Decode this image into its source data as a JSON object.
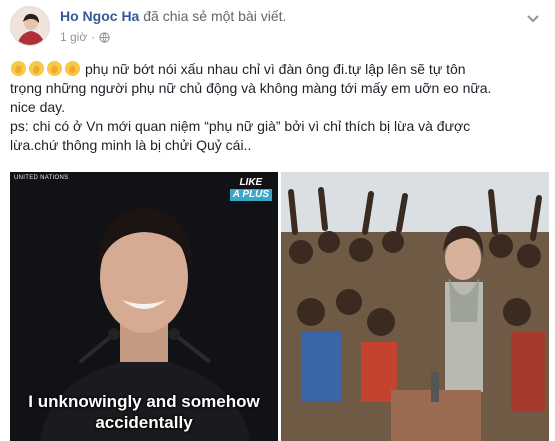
{
  "post": {
    "author_name": "Ho Ngoc Ha",
    "action": " đã chia sẻ một bài viết.",
    "time": "1 giờ",
    "privacy_icon": "globe-icon",
    "menu_icon": "chevron-down-icon",
    "lines": [
      "phụ nữ bớt nói xấu nhau chỉ vì đàn ông đi.tự lập lên sẽ tự tôn",
      "trọng những người phụ nữ chủ động và không màng tới mấy em uỡn eo nữa.",
      "nice day.",
      "ps: chi có ở Vn mới quan niệm “phụ nữ già” bởi vì chỉ thích bị lừa và được",
      "lừa.chứ thông minh là bị chửi Quỷ cái.."
    ],
    "emoji_icon": "clapping-hands-icon"
  },
  "media": {
    "left": {
      "source_label": "UNITED NATIONS",
      "brand_line1": "LIKE",
      "brand_line2": "A PLUS",
      "caption_line1": "I unknowingly and somehow",
      "caption_line2": "accidentally"
    }
  },
  "colors": {
    "author": "#365899",
    "meta": "#90949c",
    "text": "#1d2129",
    "badge": "#3aa7c9"
  }
}
